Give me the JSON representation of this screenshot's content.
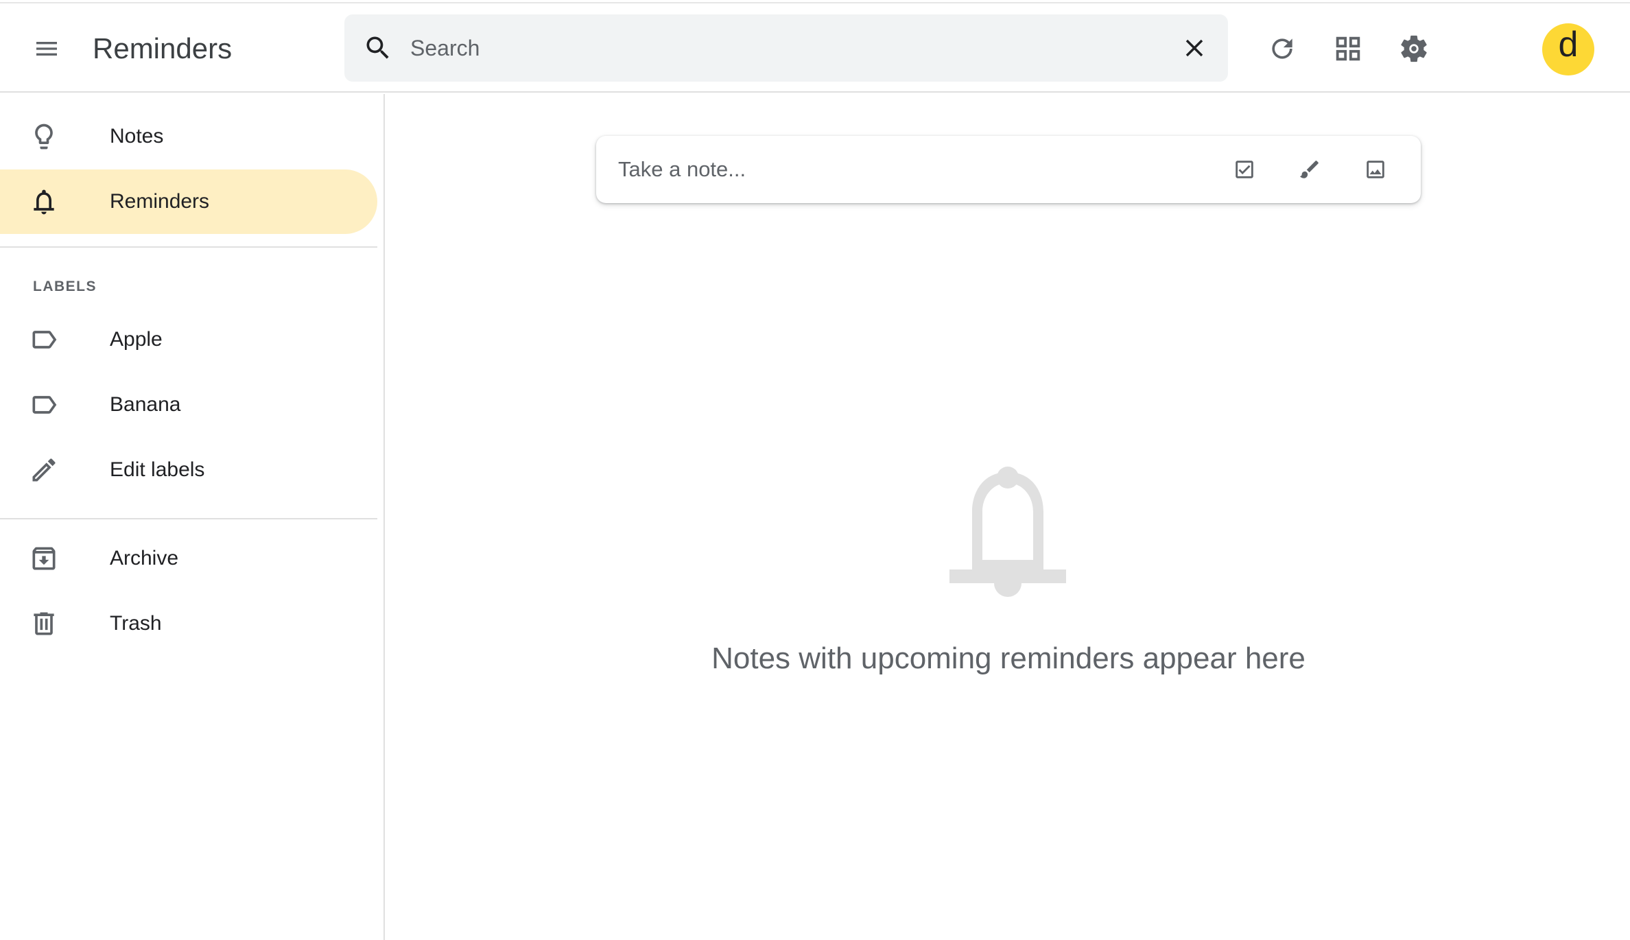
{
  "header": {
    "app_title": "Reminders",
    "search": {
      "placeholder": "Search",
      "value": ""
    },
    "avatar_letter": "d",
    "icons": [
      "menu-icon",
      "search-icon",
      "close-icon",
      "refresh-icon",
      "grid-view-icon",
      "settings-icon"
    ]
  },
  "sidebar": {
    "items": [
      {
        "label": "Notes",
        "icon": "lightbulb-icon",
        "active": false
      },
      {
        "label": "Reminders",
        "icon": "bell-icon",
        "active": true
      }
    ],
    "labels_heading": "LABELS",
    "labels": [
      {
        "label": "Apple",
        "icon": "label-icon"
      },
      {
        "label": "Banana",
        "icon": "label-icon"
      },
      {
        "label": "Edit labels",
        "icon": "pencil-icon"
      }
    ],
    "bottom_items": [
      {
        "label": "Archive",
        "icon": "archive-icon"
      },
      {
        "label": "Trash",
        "icon": "trash-icon"
      }
    ]
  },
  "main": {
    "take_note_placeholder": "Take a note...",
    "empty_state_text": "Notes with upcoming reminders appear here"
  },
  "colors": {
    "active_item_bg": "#feefc3",
    "avatar_bg": "#fdd835",
    "search_bg": "#f1f3f4",
    "empty_icon": "#e0e0e0"
  }
}
